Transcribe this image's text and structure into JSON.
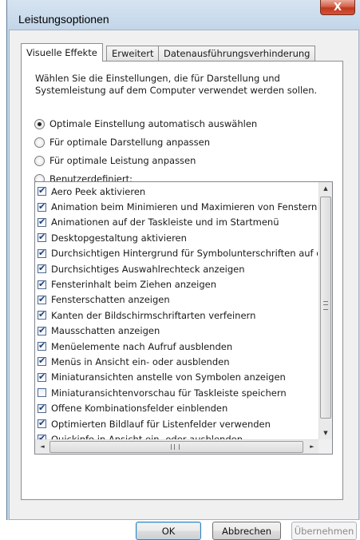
{
  "window": {
    "title": "Leistungsoptionen",
    "close_label": "X"
  },
  "tabs": [
    {
      "label": "Visuelle Effekte",
      "active": true
    },
    {
      "label": "Erweitert",
      "active": false
    },
    {
      "label": "Datenausführungsverhinderung",
      "active": false
    }
  ],
  "description": "Wählen Sie die Einstellungen, die für Darstellung und Systemleistung auf dem Computer verwendet werden sollen.",
  "radios": [
    {
      "label": "Optimale Einstellung automatisch auswählen",
      "selected": true
    },
    {
      "label": "Für optimale Darstellung anpassen",
      "selected": false
    },
    {
      "label": "Für optimale Leistung anpassen",
      "selected": false
    },
    {
      "label": "Benutzerdefiniert:",
      "selected": false
    }
  ],
  "effects": [
    {
      "label": "Aero Peek aktivieren",
      "checked": true
    },
    {
      "label": "Animation beim Minimieren und Maximieren von Fenstern",
      "checked": true
    },
    {
      "label": "Animationen auf der Taskleiste und im Startmenü",
      "checked": true
    },
    {
      "label": "Desktopgestaltung aktivieren",
      "checked": true
    },
    {
      "label": "Durchsichtigen Hintergrund für Symbolunterschriften auf d",
      "checked": true
    },
    {
      "label": "Durchsichtiges Auswahlrechteck anzeigen",
      "checked": true
    },
    {
      "label": "Fensterinhalt beim Ziehen anzeigen",
      "checked": true
    },
    {
      "label": "Fensterschatten anzeigen",
      "checked": true
    },
    {
      "label": "Kanten der Bildschirmschriftarten verfeinern",
      "checked": true
    },
    {
      "label": "Mausschatten anzeigen",
      "checked": true
    },
    {
      "label": "Menüelemente nach Aufruf ausblenden",
      "checked": true
    },
    {
      "label": "Menüs in Ansicht ein- oder ausblenden",
      "checked": true
    },
    {
      "label": "Miniaturansichten anstelle von Symbolen anzeigen",
      "checked": true
    },
    {
      "label": "Miniaturansichtenvorschau für Taskleiste speichern",
      "checked": false
    },
    {
      "label": "Offene Kombinationsfelder einblenden",
      "checked": true
    },
    {
      "label": "Optimierten Bildlauf für Listenfelder verwenden",
      "checked": true
    },
    {
      "label": "Quickinfo in Ansicht ein- oder ausblenden",
      "checked": true
    }
  ],
  "scroll": {
    "up": "▲",
    "down": "▼",
    "left": "◄",
    "right": "►",
    "h_grip": "III"
  },
  "buttons": {
    "ok": "OK",
    "cancel": "Abbrechen",
    "apply": "Übernehmen"
  }
}
